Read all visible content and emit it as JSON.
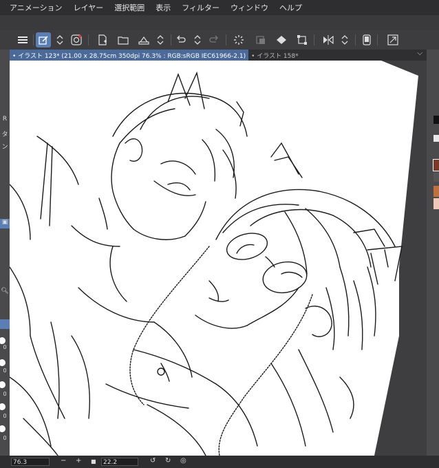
{
  "menu": {
    "items": [
      "アニメーション",
      "レイヤー",
      "選択範囲",
      "表示",
      "フィルター",
      "ウィンドウ",
      "ヘルプ"
    ]
  },
  "toolbar": {
    "icons": [
      "menu-icon",
      "edit-icon",
      "updown-icon",
      "spiral-icon",
      "new-file-icon",
      "open-folder-icon",
      "save-icon",
      "updown-icon",
      "undo-icon",
      "updown-icon",
      "redo-icon",
      "loading-icon",
      "clear-icon",
      "fill-icon",
      "transform-icon",
      "flip-icon",
      "updown-icon",
      "device-icon",
      "expand-icon"
    ]
  },
  "tabs": {
    "active": "• イラスト 123* (21.00 x 28.75cm 350dpi 76.3% : RGB:sRGB IEC61966-2.1)",
    "inactive": "• イラスト 158*"
  },
  "left_strip": {
    "labels": [
      "R",
      "タ",
      "ン"
    ],
    "values": [
      "0",
      "0",
      "0",
      "0",
      "0"
    ]
  },
  "colors": {
    "accent": "#5a7fb4",
    "swatches": [
      "#111111",
      "#e8e8e8",
      "#7a3a2a",
      "#c0703a",
      "#f0c8b8",
      "#ffffff"
    ]
  },
  "status": {
    "zoom": "76.3",
    "angle": "22.2",
    "minus": "−",
    "plus": "+"
  }
}
